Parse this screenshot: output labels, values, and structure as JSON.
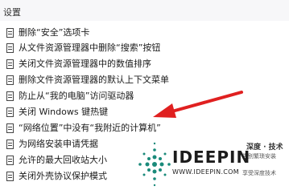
{
  "header": {
    "title": "设置"
  },
  "items": [
    {
      "label": "删除“安全”选项卡"
    },
    {
      "label": "从文件资源管理器中删除“搜索”按钮"
    },
    {
      "label": "关闭文件资源管理器中的数值排序"
    },
    {
      "label": "删除文件资源管理器的默认上下文菜单"
    },
    {
      "label": "防止从“我的电脑”访问驱动器"
    },
    {
      "label": "关闭 Windows 键热键"
    },
    {
      "label": "“网络位置”中没有“我附近的计算机”"
    },
    {
      "label": "为网络安装申请凭据"
    },
    {
      "label": "允许的最大回收站大小"
    },
    {
      "label": "关闭外壳协议保护模式"
    }
  ],
  "watermark": {
    "logo_text": "IDEEPIN",
    "cn_title": "深度 · 技术",
    "url": "WWW.IDEEPIN.COM",
    "tagline1": "告别繁琐安装",
    "tagline2": "享受深度技术",
    "accent_color": "#1a8a7a"
  },
  "colors": {
    "arrow": "#e02020"
  }
}
